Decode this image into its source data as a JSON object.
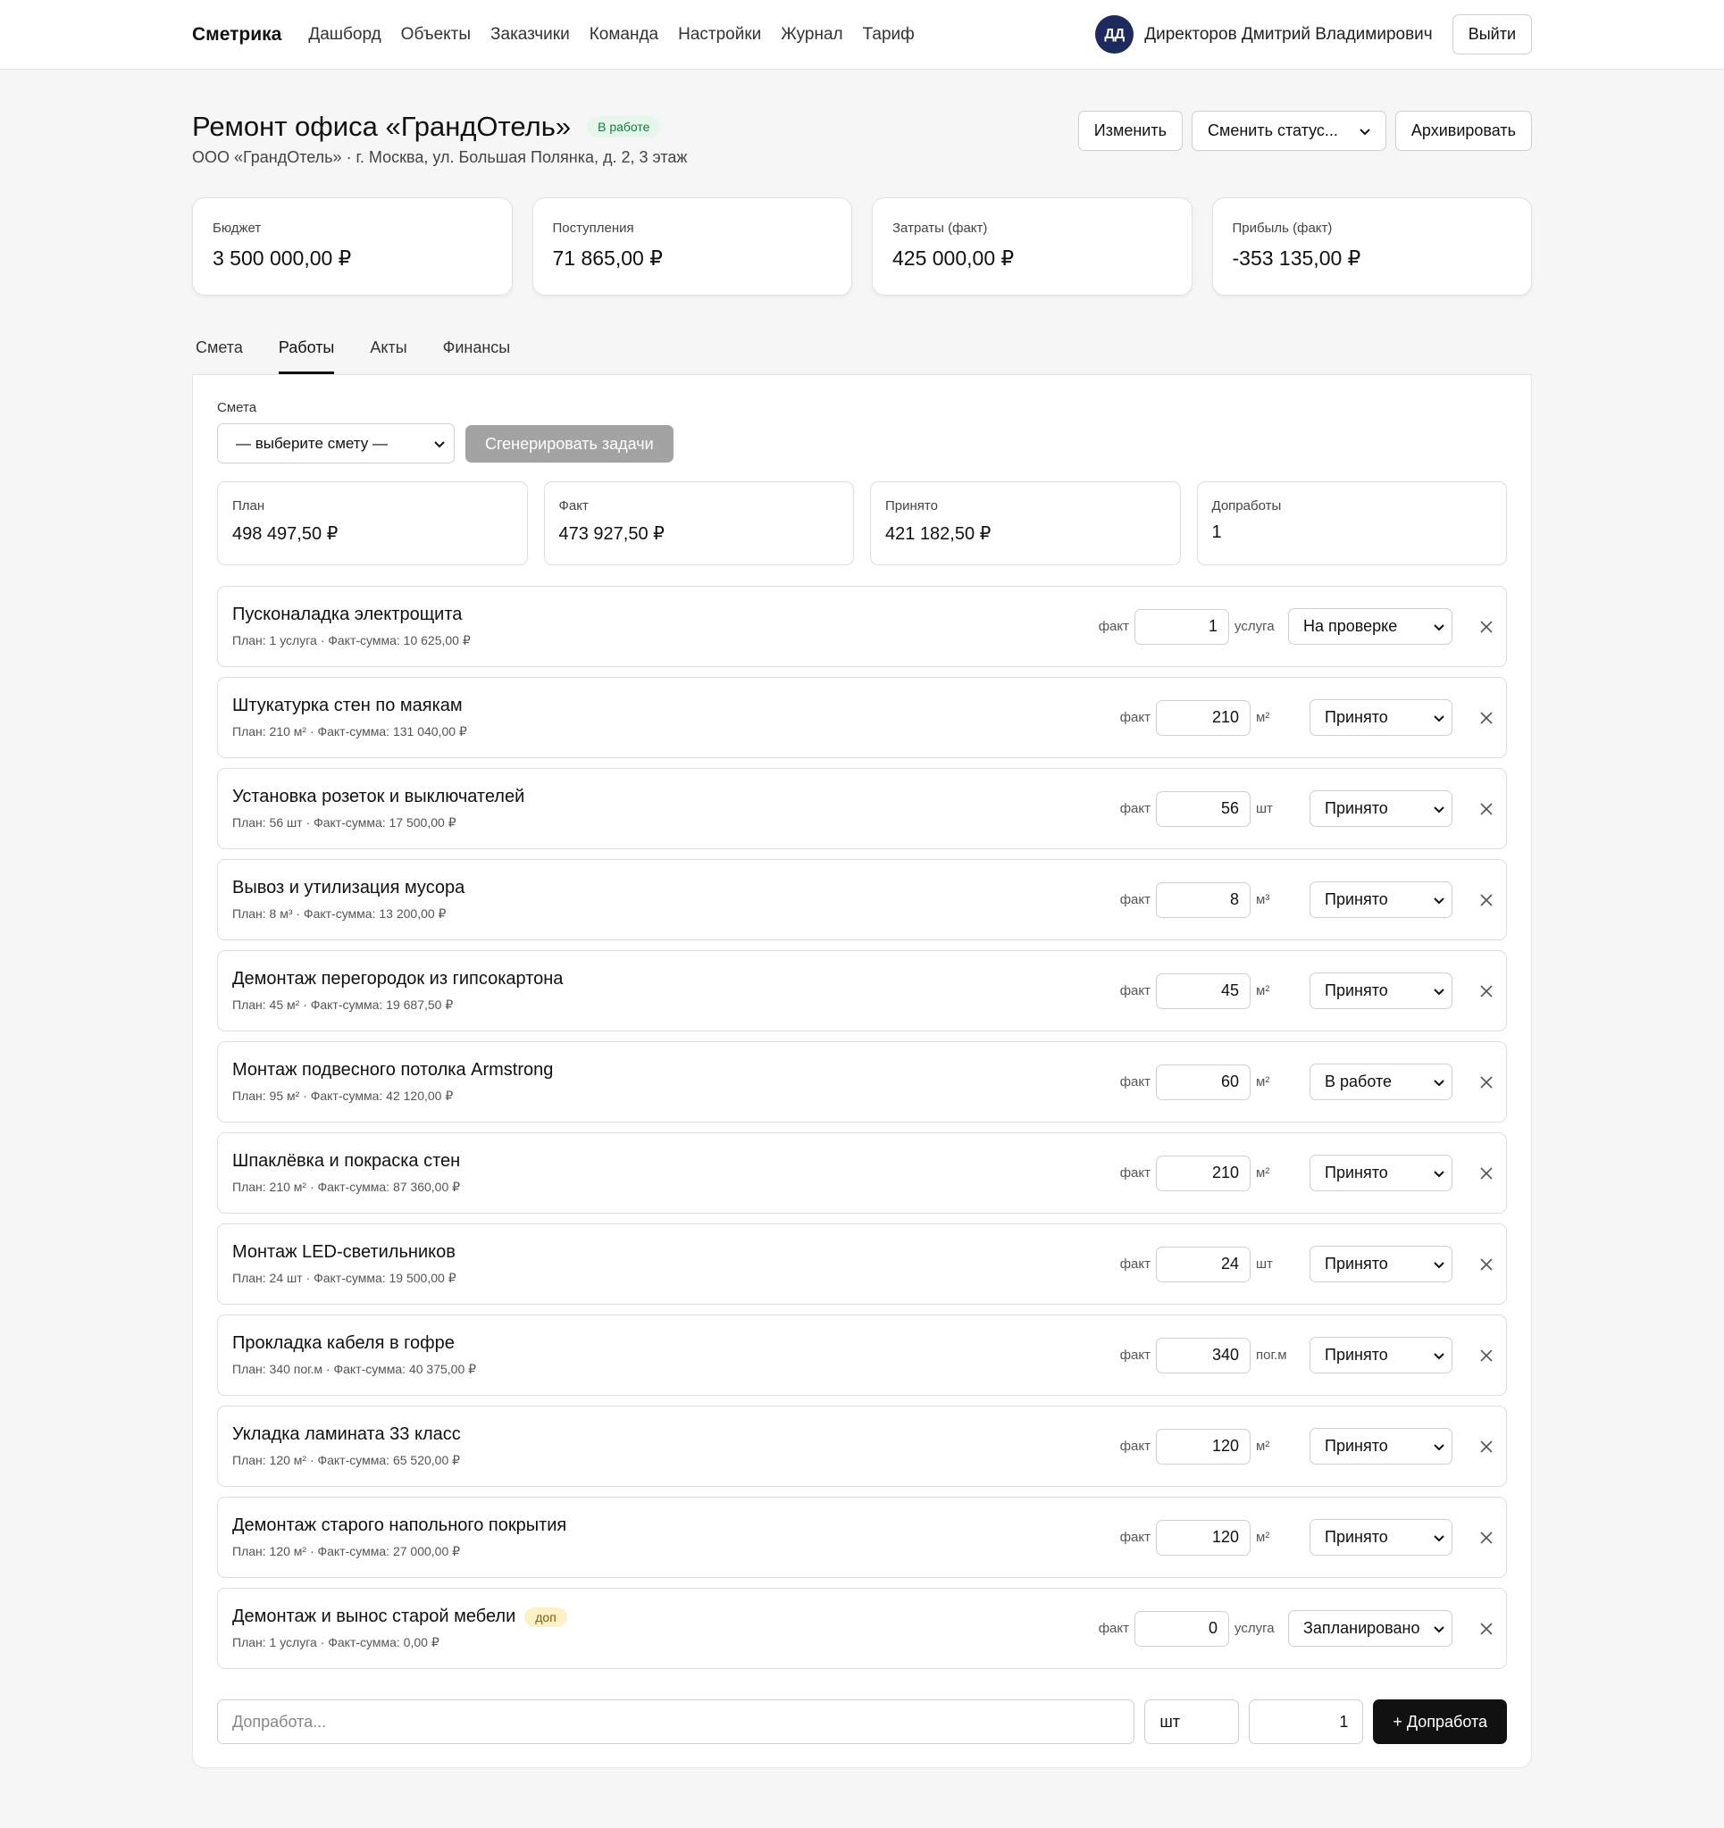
{
  "nav": {
    "brand": "Сметрика",
    "links": [
      "Дашборд",
      "Объекты",
      "Заказчики",
      "Команда",
      "Настройки",
      "Журнал",
      "Тариф"
    ],
    "user_initials": "ДД",
    "user_name": "Директоров Дмитрий Владимирович",
    "logout": "Выйти"
  },
  "project": {
    "title": "Ремонт офиса «ГрандОтель»",
    "status": "В работе",
    "subtitle": "ООО «ГрандОтель» · г. Москва, ул. Большая Полянка, д. 2, 3 этаж",
    "actions": {
      "edit": "Изменить",
      "change_status": "Сменить статус...",
      "archive": "Архивировать"
    }
  },
  "stats": [
    {
      "label": "Бюджет",
      "value": "3 500 000,00 ₽"
    },
    {
      "label": "Поступления",
      "value": "71 865,00 ₽"
    },
    {
      "label": "Затраты (факт)",
      "value": "425 000,00 ₽"
    },
    {
      "label": "Прибыль (факт)",
      "value": "-353 135,00 ₽"
    }
  ],
  "tabs": [
    "Смета",
    "Работы",
    "Акты",
    "Финансы"
  ],
  "active_tab": "Работы",
  "works": {
    "estimate_label": "Смета",
    "estimate_select": "— выберите смету —",
    "generate_button": "Сгенерировать задачи",
    "summary": [
      {
        "label": "План",
        "value": "498 497,50 ₽"
      },
      {
        "label": "Факт",
        "value": "473 927,50 ₽"
      },
      {
        "label": "Принято",
        "value": "421 182,50 ₽"
      },
      {
        "label": "Допработы",
        "value": "1"
      }
    ],
    "fact_label": "факт",
    "tasks": [
      {
        "name": "Пусконаладка электрощита",
        "meta": "План: 1 услуга · Факт-сумма: 10 625,00 ₽",
        "fact": "1",
        "unit": "услуга",
        "status": "На проверке"
      },
      {
        "name": "Штукатурка стен по маякам",
        "meta": "План: 210 м² · Факт-сумма: 131 040,00 ₽",
        "fact": "210",
        "unit": "м²",
        "status": "Принято"
      },
      {
        "name": "Установка розеток и выключателей",
        "meta": "План: 56 шт · Факт-сумма: 17 500,00 ₽",
        "fact": "56",
        "unit": "шт",
        "status": "Принято"
      },
      {
        "name": "Вывоз и утилизация мусора",
        "meta": "План: 8 м³ · Факт-сумма: 13 200,00 ₽",
        "fact": "8",
        "unit": "м³",
        "status": "Принято"
      },
      {
        "name": "Демонтаж перегородок из гипсокартона",
        "meta": "План: 45 м² · Факт-сумма: 19 687,50 ₽",
        "fact": "45",
        "unit": "м²",
        "status": "Принято"
      },
      {
        "name": "Монтаж подвесного потолка Armstrong",
        "meta": "План: 95 м² · Факт-сумма: 42 120,00 ₽",
        "fact": "60",
        "unit": "м²",
        "status": "В работе"
      },
      {
        "name": "Шпаклёвка и покраска стен",
        "meta": "План: 210 м² · Факт-сумма: 87 360,00 ₽",
        "fact": "210",
        "unit": "м²",
        "status": "Принято"
      },
      {
        "name": "Монтаж LED-светильников",
        "meta": "План: 24 шт · Факт-сумма: 19 500,00 ₽",
        "fact": "24",
        "unit": "шт",
        "status": "Принято"
      },
      {
        "name": "Прокладка кабеля в гофре",
        "meta": "План: 340 пог.м · Факт-сумма: 40 375,00 ₽",
        "fact": "340",
        "unit": "пог.м",
        "status": "Принято"
      },
      {
        "name": "Укладка ламината 33 класс",
        "meta": "План: 120 м² · Факт-сумма: 65 520,00 ₽",
        "fact": "120",
        "unit": "м²",
        "status": "Принято"
      },
      {
        "name": "Демонтаж старого напольного покрытия",
        "meta": "План: 120 м² · Факт-сумма: 27 000,00 ₽",
        "fact": "120",
        "unit": "м²",
        "status": "Принято"
      },
      {
        "name": "Демонтаж и вынос старой мебели",
        "badge": "доп",
        "meta": "План: 1 услуга · Факт-сумма: 0,00 ₽",
        "fact": "0",
        "unit": "услуга",
        "status": "Запланировано"
      }
    ],
    "add": {
      "placeholder": "Допработа...",
      "unit": "шт",
      "qty": "1",
      "button": "+ Допработа"
    }
  }
}
